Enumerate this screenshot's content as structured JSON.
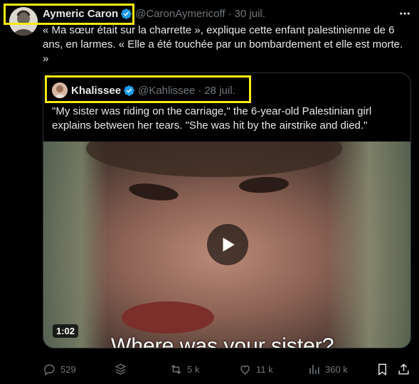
{
  "tweet": {
    "author_name": "Aymeric Caron",
    "author_handle": "@CaronAymericoff",
    "separator": "·",
    "date": "30 juil.",
    "text": "« Ma sœur était sur la charrette », explique cette enfant palestinienne de 6 ans, en larmes. « Elle a été touchée par un bombardement et elle est morte. »"
  },
  "quote": {
    "author_name": "Khalissee",
    "author_handle": "@Kahlissee",
    "separator": "·",
    "date": "28 juil.",
    "text": "\"My sister was riding on the carriage,\" the 6-year-old Palestinian girl explains between her tears. \"She was hit by the airstrike and died.\"",
    "video": {
      "duration": "1:02",
      "subtitle": "Where was your sister?"
    }
  },
  "actions": {
    "replies": "529",
    "reposts": "5 k",
    "likes": "11 k",
    "views": "360 k"
  },
  "colors": {
    "highlight": "#f7ec13",
    "verified": "#1d9bf0",
    "muted": "#71767b",
    "text": "#e7e9ea",
    "background": "#000000"
  },
  "icons": [
    "more-icon",
    "verified-icon",
    "play-icon",
    "reply-icon",
    "grok-icon",
    "repost-icon",
    "like-icon",
    "views-icon",
    "bookmark-icon",
    "share-icon"
  ]
}
